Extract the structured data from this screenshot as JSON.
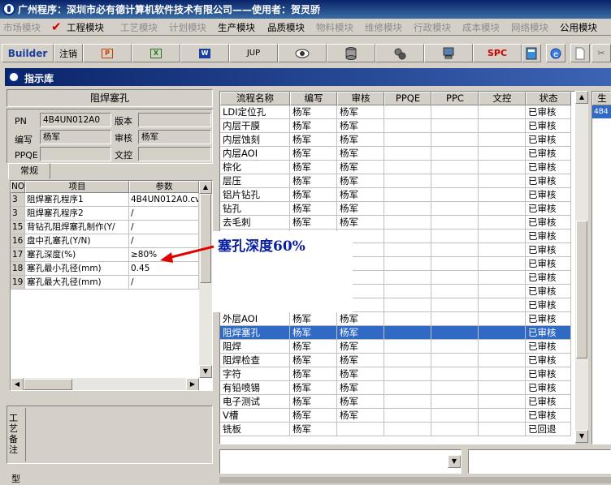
{
  "titlebar": {
    "title": "广州程序：深圳市必有德计算机软件技术有限公司——使用者：贺灵骄"
  },
  "menu": [
    {
      "label": "市场模块",
      "active": false
    },
    {
      "label": "工程模块",
      "active": true
    },
    {
      "label": "工艺模块",
      "active": false
    },
    {
      "label": "计划模块",
      "active": false
    },
    {
      "label": "生产模块",
      "active": true
    },
    {
      "label": "品质模块",
      "active": true
    },
    {
      "label": "物料模块",
      "active": false
    },
    {
      "label": "维修模块",
      "active": false
    },
    {
      "label": "行政模块",
      "active": false
    },
    {
      "label": "成本模块",
      "active": false
    },
    {
      "label": "网络模块",
      "active": false
    },
    {
      "label": "公用模块",
      "active": true
    }
  ],
  "toolbar": {
    "builder": "Builder",
    "logout": "注销",
    "jup": "JUP",
    "spc": "SPC",
    "icons": [
      "ppt-icon",
      "excel-icon",
      "word-icon",
      "eye-icon",
      "database-icon",
      "gears-icon",
      "computer-icon",
      "calculator-icon",
      "ie-icon",
      "page-icon",
      "scissors-icon"
    ]
  },
  "window": {
    "title": "指示库"
  },
  "left": {
    "heading": "阻焊塞孔",
    "pn_label": "PN",
    "pn_value": "4B4UN012A0",
    "version_label": "版本",
    "version_value": "",
    "author_label": "编写",
    "author_value": "杨军",
    "review_label": "审核",
    "review_value": "杨军",
    "ppqe_label": "PPQE",
    "ppqe_value": "",
    "wenkong_label": "文控",
    "wenkong_value": "",
    "tab": "常规",
    "grid_headers": [
      "NO",
      "项目",
      "参数"
    ],
    "grid_rows": [
      {
        "no": "3",
        "item": "阻焊塞孔程序1",
        "param": "4B4UN012A0.cv"
      },
      {
        "no": "3",
        "item": "阻焊塞孔程序2",
        "param": "/"
      },
      {
        "no": "15",
        "item": "背钻孔阻焊塞孔制作(Y/",
        "param": "/"
      },
      {
        "no": "16",
        "item": "盘中孔塞孔(Y/N)",
        "param": "/"
      },
      {
        "no": "17",
        "item": "塞孔深度(%)",
        "param": "≥80%"
      },
      {
        "no": "18",
        "item": "塞孔最小孔径(mm)",
        "param": "0.45"
      },
      {
        "no": "19",
        "item": "塞孔最大孔径(mm)",
        "param": "/"
      }
    ],
    "notes_label_1": "工艺备注",
    "notes_label_2": "型"
  },
  "main": {
    "headers": [
      "流程名称",
      "编写",
      "审核",
      "PPQE",
      "PPC",
      "文控",
      "状态"
    ],
    "rows": [
      {
        "name": "LDI定位孔",
        "author": "杨军",
        "reviewer": "杨军",
        "status": "已审核"
      },
      {
        "name": "内层干膜",
        "author": "杨军",
        "reviewer": "杨军",
        "status": "已审核"
      },
      {
        "name": "内层蚀刻",
        "author": "杨军",
        "reviewer": "杨军",
        "status": "已审核"
      },
      {
        "name": "内层AOI",
        "author": "杨军",
        "reviewer": "杨军",
        "status": "已审核"
      },
      {
        "name": "棕化",
        "author": "杨军",
        "reviewer": "杨军",
        "status": "已审核"
      },
      {
        "name": "层压",
        "author": "杨军",
        "reviewer": "杨军",
        "status": "已审核"
      },
      {
        "name": "铝片钻孔",
        "author": "杨军",
        "reviewer": "杨军",
        "status": "已审核"
      },
      {
        "name": "钻孔",
        "author": "杨军",
        "reviewer": "杨军",
        "status": "已审核"
      },
      {
        "name": "去毛刺",
        "author": "杨军",
        "reviewer": "杨军",
        "status": "已审核"
      },
      {
        "name": "",
        "author": "",
        "reviewer": "",
        "status": "已审核"
      },
      {
        "name": "",
        "author": "",
        "reviewer": "",
        "status": "已审核"
      },
      {
        "name": "",
        "author": "",
        "reviewer": "",
        "status": "已审核"
      },
      {
        "name": "",
        "author": "",
        "reviewer": "",
        "status": "已审核"
      },
      {
        "name": "",
        "author": "",
        "reviewer": "",
        "status": "已审核"
      },
      {
        "name": "",
        "author": "",
        "reviewer": "",
        "status": "已审核"
      },
      {
        "name": "外层AOI",
        "author": "杨军",
        "reviewer": "杨军",
        "status": "已审核"
      },
      {
        "name": "阻焊塞孔",
        "author": "杨军",
        "reviewer": "杨军",
        "status": "已审核",
        "selected": true
      },
      {
        "name": "阻焊",
        "author": "杨军",
        "reviewer": "杨军",
        "status": "已审核"
      },
      {
        "name": "阻焊检查",
        "author": "杨军",
        "reviewer": "杨军",
        "status": "已审核"
      },
      {
        "name": "字符",
        "author": "杨军",
        "reviewer": "杨军",
        "status": "已审核"
      },
      {
        "name": "有铅喷锡",
        "author": "杨军",
        "reviewer": "杨军",
        "status": "已审核"
      },
      {
        "name": "电子测试",
        "author": "杨军",
        "reviewer": "杨军",
        "status": "已审核"
      },
      {
        "name": "V槽",
        "author": "杨军",
        "reviewer": "杨军",
        "status": "已审核"
      },
      {
        "name": "铣板",
        "author": "杨军",
        "reviewer": "",
        "status": "已回退"
      }
    ]
  },
  "right_edge": {
    "header": "生",
    "cell": "4B4"
  },
  "annotation": {
    "text": "塞孔深度60%"
  }
}
